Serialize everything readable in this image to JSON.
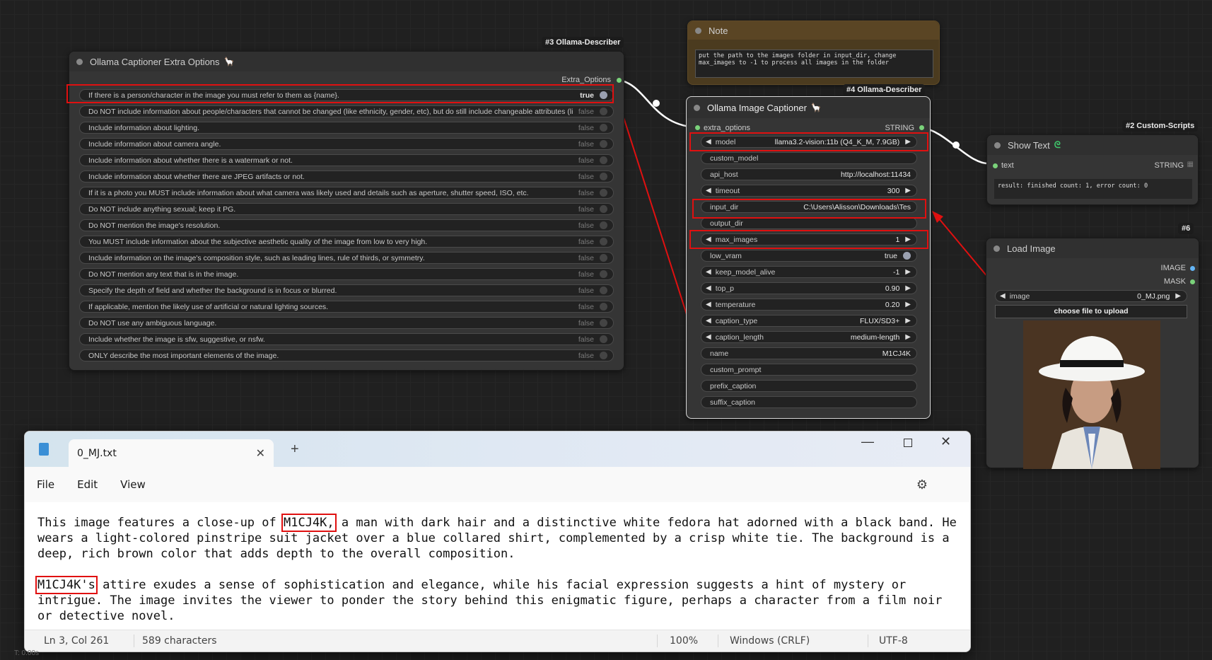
{
  "extra_options_node": {
    "badge": "#3 Ollama-Describer",
    "title": "Ollama Captioner Extra Options",
    "output_label": "Extra_Options",
    "options": [
      {
        "label": "If there is a person/character in the image you must refer to them as {name}.",
        "value": "true"
      },
      {
        "label": "Do NOT include information about people/characters that cannot be changed (like ethnicity, gender, etc), but do still include changeable attributes (like hair style).",
        "value": "false"
      },
      {
        "label": "Include information about lighting.",
        "value": "false"
      },
      {
        "label": "Include information about camera angle.",
        "value": "false"
      },
      {
        "label": "Include information about whether there is a watermark or not.",
        "value": "false"
      },
      {
        "label": "Include information about whether there are JPEG artifacts or not.",
        "value": "false"
      },
      {
        "label": "If it is a photo you MUST include information about what camera was likely used and details such as aperture, shutter speed, ISO, etc.",
        "value": "false"
      },
      {
        "label": "Do NOT include anything sexual; keep it PG.",
        "value": "false"
      },
      {
        "label": "Do NOT mention the image's resolution.",
        "value": "false"
      },
      {
        "label": "You MUST include information about the subjective aesthetic quality of the image from low to very high.",
        "value": "false"
      },
      {
        "label": "Include information on the image's composition style, such as leading lines, rule of thirds, or symmetry.",
        "value": "false"
      },
      {
        "label": "Do NOT mention any text that is in the image.",
        "value": "false"
      },
      {
        "label": "Specify the depth of field and whether the background is in focus or blurred.",
        "value": "false"
      },
      {
        "label": "If applicable, mention the likely use of artificial or natural lighting sources.",
        "value": "false"
      },
      {
        "label": "Do NOT use any ambiguous language.",
        "value": "false"
      },
      {
        "label": "Include whether the image is sfw, suggestive, or nsfw.",
        "value": "false"
      },
      {
        "label": "ONLY describe the most important elements of the image.",
        "value": "false"
      }
    ]
  },
  "note_node": {
    "title": "Note",
    "text": "put the path to the images folder in input_dir, change\nmax_images to -1 to process all images in the folder"
  },
  "captioner_node": {
    "badge": "#4 Ollama-Describer",
    "title": "Ollama Image Captioner",
    "input_label": "extra_options",
    "output_label": "STRING",
    "widgets": {
      "model": {
        "label": "model",
        "value": "llama3.2-vision:11b (Q4_K_M, 7.9GB)"
      },
      "custom_model": {
        "label": "custom_model",
        "value": ""
      },
      "api_host": {
        "label": "api_host",
        "value": "http://localhost:11434"
      },
      "timeout": {
        "label": "timeout",
        "value": "300"
      },
      "input_dir": {
        "label": "input_dir",
        "value": "C:\\Users\\Alisson\\Downloads\\Tes"
      },
      "output_dir": {
        "label": "output_dir",
        "value": ""
      },
      "max_images": {
        "label": "max_images",
        "value": "1"
      },
      "low_vram": {
        "label": "low_vram",
        "value": "true"
      },
      "keep_model_alive": {
        "label": "keep_model_alive",
        "value": "-1"
      },
      "top_p": {
        "label": "top_p",
        "value": "0.90"
      },
      "temperature": {
        "label": "temperature",
        "value": "0.20"
      },
      "caption_type": {
        "label": "caption_type",
        "value": "FLUX/SD3+"
      },
      "caption_length": {
        "label": "caption_length",
        "value": "medium-length"
      },
      "name": {
        "label": "name",
        "value": "M1CJ4K"
      },
      "custom_prompt": {
        "label": "custom_prompt",
        "value": ""
      },
      "prefix_caption": {
        "label": "prefix_caption",
        "value": ""
      },
      "suffix_caption": {
        "label": "suffix_caption",
        "value": ""
      }
    }
  },
  "show_text_node": {
    "badge": "#2 Custom-Scripts",
    "title": "Show Text",
    "input_label": "text",
    "output_label": "STRING",
    "result": "result: finished count: 1, error count: 0"
  },
  "load_image_node": {
    "badge": "#6",
    "title": "Load Image",
    "output_image": "IMAGE",
    "output_mask": "MASK",
    "image_label": "image",
    "image_value": "0_MJ.png",
    "upload_label": "choose file to upload"
  },
  "notepad": {
    "tab_title": "0_MJ.txt",
    "menu": [
      "File",
      "Edit",
      "View"
    ],
    "p1_before": "This image features a close-up of ",
    "p1_name": "M1CJ4K,",
    "p1_after": " a man with dark hair and a distinctive white fedora hat adorned with a black band. He wears a light-colored pinstripe suit jacket over a blue collared shirt, complemented by a crisp white tie. The background is a deep, rich brown color that adds depth to the overall composition.",
    "p2_name": "M1CJ4K's",
    "p2_after": " attire exudes a sense of sophistication and elegance, while his facial expression suggests a hint of mystery or intrigue. The image invites the viewer to ponder the story behind this enigmatic figure, perhaps a character from a film noir or detective novel.",
    "status": {
      "position": "Ln 3, Col 261",
      "chars": "589 characters",
      "zoom": "100%",
      "line_ending": "Windows (CRLF)",
      "encoding": "UTF-8"
    }
  },
  "footer_text": "T: 0.00s",
  "colors": {
    "highlight": "#e01010",
    "slot": "#7ad27a",
    "canvas": "#202020"
  }
}
